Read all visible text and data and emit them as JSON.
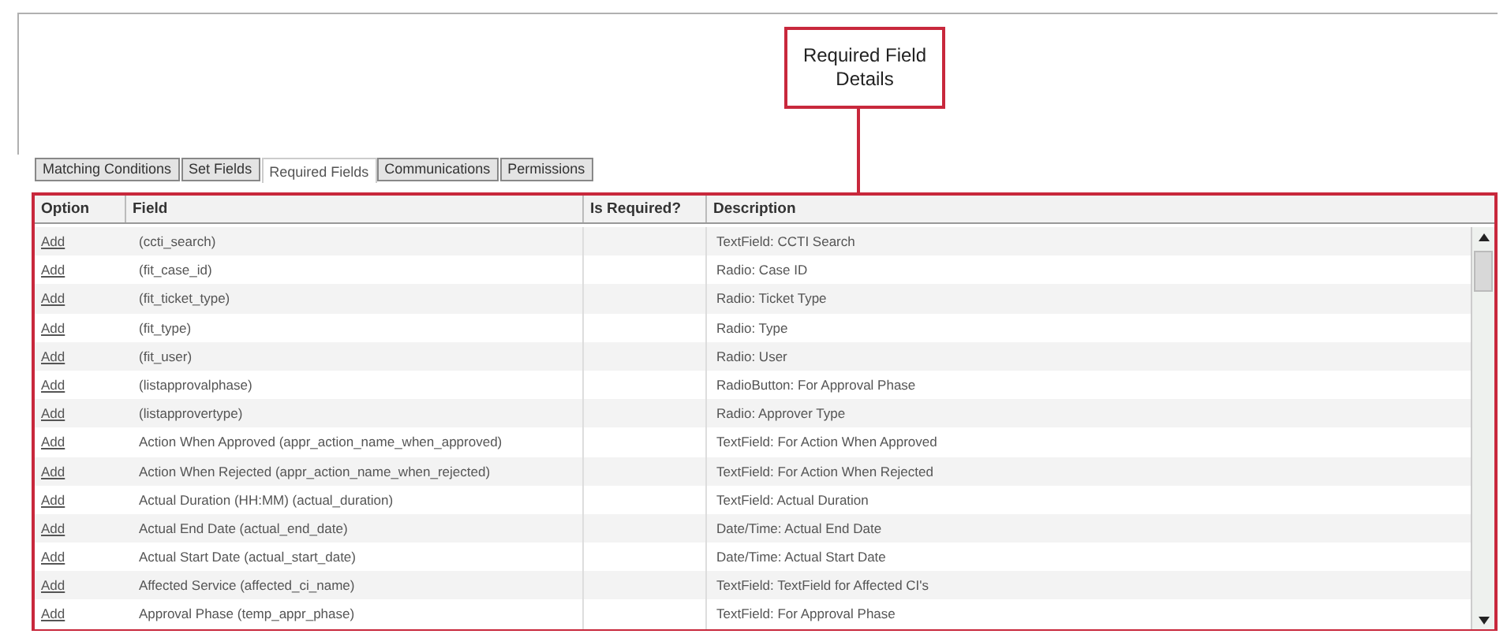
{
  "callout": {
    "text": "Required Field Details"
  },
  "tabs": [
    {
      "label": "Matching Conditions",
      "selected": false
    },
    {
      "label": "Set Fields",
      "selected": false
    },
    {
      "label": "Required Fields",
      "selected": true
    },
    {
      "label": "Communications",
      "selected": false
    },
    {
      "label": "Permissions",
      "selected": false
    }
  ],
  "table": {
    "columns": [
      "Option",
      "Field",
      "Is Required?",
      "Description"
    ],
    "rows": [
      {
        "option": "Add",
        "field": "(ccti_search)",
        "description": "TextField: CCTI Search"
      },
      {
        "option": "Add",
        "field": "(fit_case_id)",
        "description": "Radio: Case ID"
      },
      {
        "option": "Add",
        "field": "(fit_ticket_type)",
        "description": "Radio: Ticket Type"
      },
      {
        "option": "Add",
        "field": "(fit_type)",
        "description": "Radio: Type"
      },
      {
        "option": "Add",
        "field": "(fit_user)",
        "description": "Radio: User"
      },
      {
        "option": "Add",
        "field": "(listapprovalphase)",
        "description": "RadioButton: For Approval Phase"
      },
      {
        "option": "Add",
        "field": "(listapprovertype)",
        "description": "Radio: Approver Type"
      },
      {
        "option": "Add",
        "field": "Action When Approved (appr_action_name_when_approved)",
        "description": "TextField: For Action When Approved"
      },
      {
        "option": "Add",
        "field": "Action When Rejected (appr_action_name_when_rejected)",
        "description": "TextField: For Action When Rejected"
      },
      {
        "option": "Add",
        "field": "Actual Duration (HH:MM) (actual_duration)",
        "description": "TextField: Actual Duration"
      },
      {
        "option": "Add",
        "field": "Actual End Date (actual_end_date)",
        "description": "Date/Time: Actual End Date"
      },
      {
        "option": "Add",
        "field": "Actual Start Date (actual_start_date)",
        "description": "Date/Time: Actual Start Date"
      },
      {
        "option": "Add",
        "field": "Affected Service (affected_ci_name)",
        "description": "TextField: TextField for Affected CI's"
      },
      {
        "option": "Add",
        "field": "Approval Phase (temp_appr_phase)",
        "description": "TextField: For Approval Phase"
      }
    ]
  }
}
